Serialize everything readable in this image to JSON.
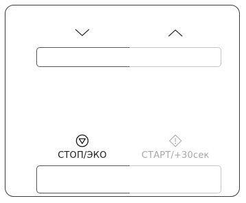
{
  "panel": {
    "stop": {
      "label": "СТОП/ЭКО",
      "icon": "stop-triangle-icon",
      "enabled": true
    },
    "start": {
      "label": "СТАРТ/+30сек",
      "icon": "start-diamond-icon",
      "enabled": false
    },
    "nav": {
      "down_icon": "chevron-down-icon",
      "up_icon": "chevron-up-icon"
    }
  },
  "colors": {
    "active": "#1a1a1a",
    "disabled": "#a8a8a8",
    "border": "#3a3a3a"
  }
}
